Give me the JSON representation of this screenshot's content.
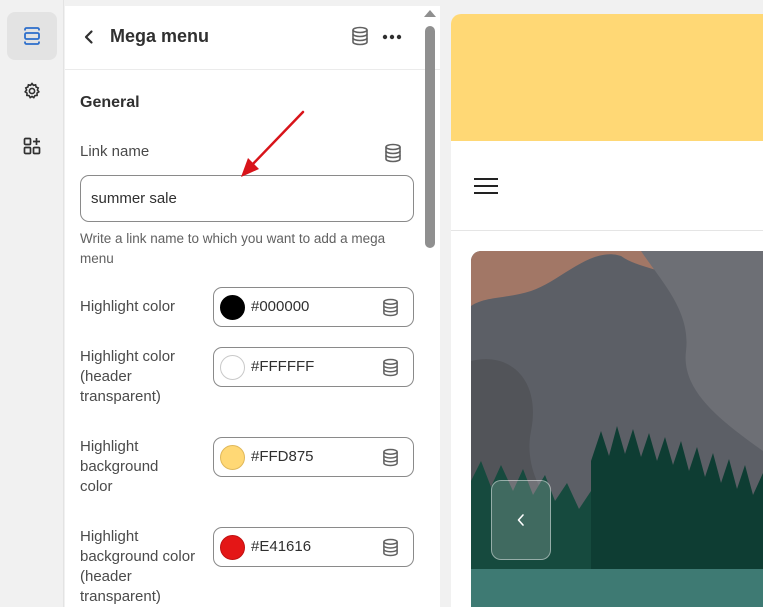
{
  "rail": {
    "items": [
      {
        "icon": "sections-icon",
        "active": true
      },
      {
        "icon": "gear-icon",
        "active": false
      },
      {
        "icon": "apps-add-icon",
        "active": false
      }
    ]
  },
  "panel": {
    "title": "Mega menu",
    "section_title": "General",
    "link_name": {
      "label": "Link name",
      "value": "summer sale",
      "help": "Write a link name to which you want to add a mega menu"
    },
    "colors": [
      {
        "label": "Highlight color",
        "value": "#000000",
        "swatch": "#000000"
      },
      {
        "label": "Highlight color (header transparent)",
        "value": "#FFFFFF",
        "swatch": "#FFFFFF"
      },
      {
        "label": "Highlight background color",
        "value": "#FFD875",
        "swatch": "#FFD875"
      },
      {
        "label": "Highlight background color (header transparent)",
        "value": "#E41616",
        "swatch": "#E41616"
      }
    ]
  },
  "preview": {
    "announcement_color": "#FFD875",
    "menu_icon": "hamburger-icon",
    "slide_prev_icon": "chevron-left-icon"
  }
}
